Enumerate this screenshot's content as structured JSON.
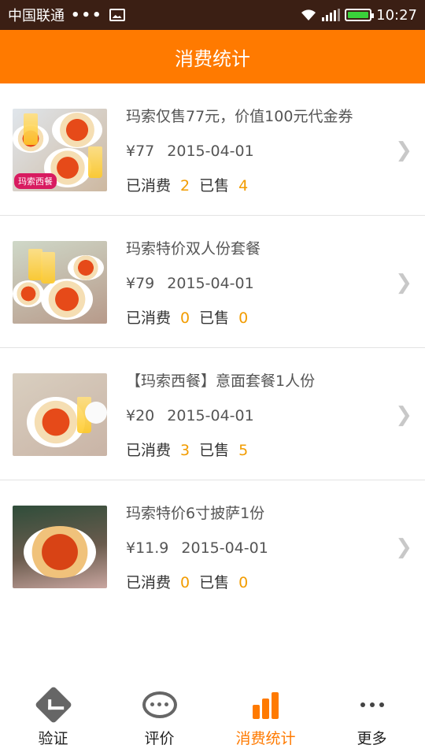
{
  "status_bar": {
    "carrier": "中国联通",
    "dots": "•••",
    "time": "10:27"
  },
  "header": {
    "title": "消费统计"
  },
  "labels": {
    "consumed": "已消费",
    "sold": "已售"
  },
  "items": [
    {
      "title": "玛索仅售77元，价值100元代金券",
      "price": "¥77",
      "date": "2015-04-01",
      "consumed": "2",
      "sold": "4",
      "badge": "玛索西餐"
    },
    {
      "title": "玛索特价双人份套餐",
      "price": "¥79",
      "date": "2015-04-01",
      "consumed": "0",
      "sold": "0"
    },
    {
      "title": "【玛索西餐】意面套餐1人份",
      "price": "¥20",
      "date": "2015-04-01",
      "consumed": "3",
      "sold": "5"
    },
    {
      "title": "玛索特价6寸披萨1份",
      "price": "¥11.9",
      "date": "2015-04-01",
      "consumed": "0",
      "sold": "0"
    }
  ],
  "tabs": [
    {
      "label": "验证",
      "icon": "check-diamond-icon"
    },
    {
      "label": "评价",
      "icon": "chat-bubble-icon"
    },
    {
      "label": "消费统计",
      "icon": "bar-chart-icon",
      "active": true
    },
    {
      "label": "更多",
      "icon": "more-dots-icon"
    }
  ],
  "colors": {
    "accent": "#ff7a00",
    "count": "#f29c00",
    "status_bar": "#3b1f14"
  }
}
